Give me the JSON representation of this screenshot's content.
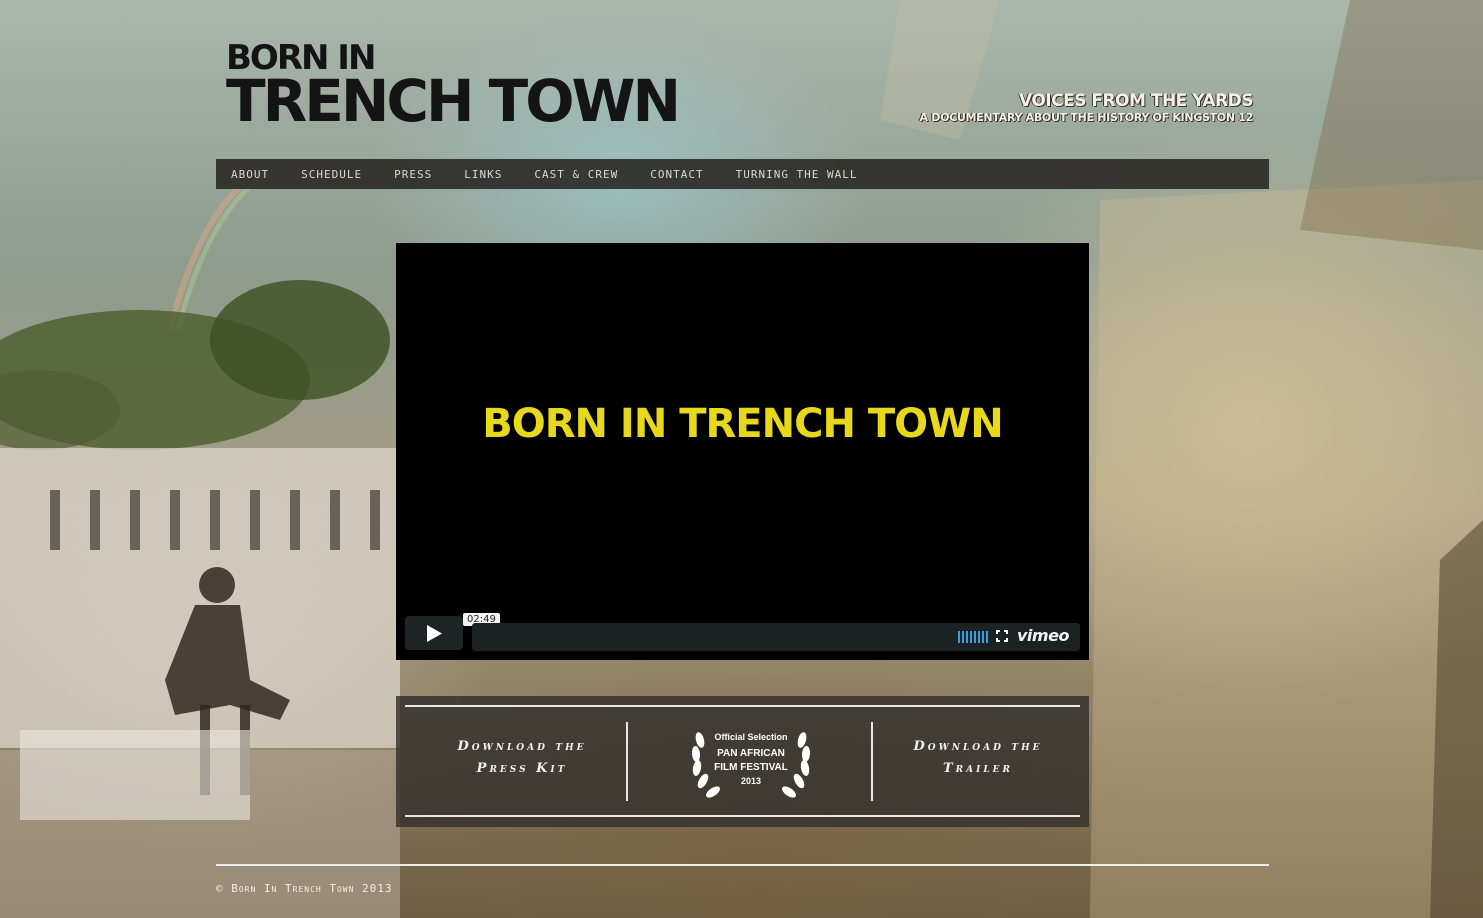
{
  "header": {
    "logo_line1": "BORN IN",
    "logo_line2": "TRENCH TOWN",
    "tagline_main": "VOICES FROM THE YARDS",
    "tagline_sub": "A DOCUMENTARY ABOUT THE HISTORY OF KINGSTON 12"
  },
  "nav": {
    "items": [
      "ABOUT",
      "SCHEDULE",
      "PRESS",
      "LINKS",
      "CAST & CREW",
      "CONTACT",
      "TURNING THE WALL"
    ]
  },
  "video": {
    "title": "BORN IN TRENCH TOWN",
    "duration": "02:49",
    "provider": "vimeo",
    "title_color": "#e8d81c",
    "icons": [
      "play-icon",
      "volume-icon",
      "fullscreen-icon"
    ]
  },
  "downloads": {
    "press_kit_line1": "Download the",
    "press_kit_line2": "Press Kit",
    "trailer_line1": "Download the",
    "trailer_line2": "Trailer",
    "laurel_line1": "Official Selection",
    "laurel_line2": "PAN AFRICAN",
    "laurel_line3": "FILM FESTIVAL",
    "laurel_line4": "2013"
  },
  "footer": {
    "copyright": "© Born In Trench Town 2013"
  }
}
